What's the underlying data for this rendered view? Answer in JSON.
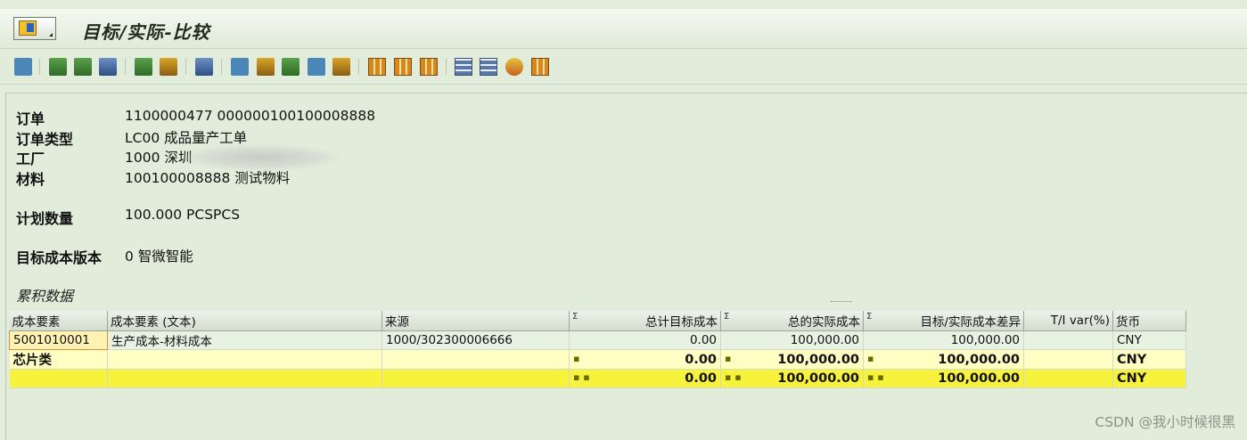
{
  "title": "目标/实际-比较",
  "toolbar": {
    "icons": [
      "detail-icon",
      "sort-ascending-icon",
      "sort-descending-icon",
      "filter-icon",
      "sum-icon",
      "subtotal-icon",
      "print-preview-icon",
      "export-icon",
      "views-icon",
      "graphic-icon",
      "abc-analysis-icon",
      "info-icon",
      "layout-grid-icon",
      "layout-insert-icon",
      "layout-change-icon",
      "calculation-icon",
      "hierarchy-icon",
      "refresh-icon",
      "select-layout-icon"
    ]
  },
  "header": {
    "order_label": "订单",
    "order_value": "1100000477 000000100100008888",
    "order_type_label": "订单类型",
    "order_type_value": "LC00 成品量产工单",
    "plant_label": "工厂",
    "plant_value": "1000 深圳",
    "material_label": "材料",
    "material_value": "100100008888 测试物料",
    "planned_qty_label": "计划数量",
    "planned_qty_value": "100.000 PCSPCS",
    "target_version_label": "目标成本版本",
    "target_version_value": "0 智微智能"
  },
  "section_title": "累积数据",
  "table": {
    "columns": {
      "cost_element": "成本要素",
      "cost_element_text": "成本要素 (文本)",
      "origin": "来源",
      "sigma": "Σ",
      "total_target": "总计目标成本",
      "total_actual": "总的实际成本",
      "variance": "目标/实际成本差异",
      "ti_var": "T/I var(%)",
      "currency": "货币"
    },
    "row": {
      "cost_element": "5001010001",
      "cost_element_text": "生产成本-材料成本",
      "origin": "1000/302300006666",
      "total_target": "0.00",
      "total_actual": "100,000.00",
      "variance": "100,000.00",
      "ti_var": "",
      "currency": "CNY"
    },
    "subtotal": {
      "label": "芯片类",
      "marker": "▪",
      "total_target": "0.00",
      "total_actual": "100,000.00",
      "variance": "100,000.00",
      "currency": "CNY"
    },
    "total": {
      "marker": "▪ ▪",
      "total_target": "0.00",
      "total_actual": "100,000.00",
      "variance": "100,000.00",
      "currency": "CNY"
    }
  },
  "watermark": "CSDN @我小时候很黑"
}
